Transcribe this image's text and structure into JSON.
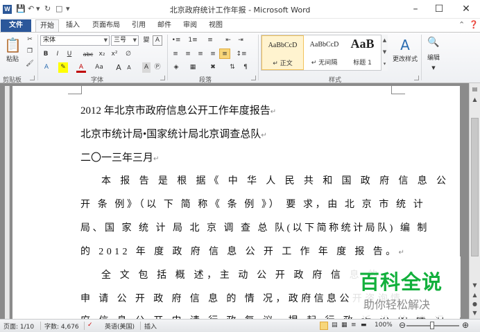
{
  "titlebar": {
    "app_icon": "W",
    "title": "北京政府统计工作年报 - Microsoft Word",
    "qat": [
      "save-icon",
      "undo-icon",
      "redo-icon",
      "new-doc-icon",
      "customize-qat-icon"
    ],
    "buttons": [
      "minimize-icon",
      "maximize-icon",
      "close-icon"
    ]
  },
  "tabs": [
    "文件",
    "开始",
    "插入",
    "页面布局",
    "引用",
    "邮件",
    "审阅",
    "视图"
  ],
  "ribbon": {
    "clipboard": {
      "paste": "粘贴",
      "label": "剪贴板"
    },
    "font": {
      "name": "宋体",
      "size": "三号",
      "wen": "變",
      "A_box": "A",
      "label": "字体",
      "row2": [
        "B",
        "I",
        "U",
        "abc",
        "x₂",
        "x²"
      ],
      "row3": [
        "Aa",
        "A",
        "A"
      ]
    },
    "paragraph": {
      "label": "段落"
    },
    "styles": {
      "items": [
        {
          "preview": "AaBbCcD",
          "name": "↵ 正文"
        },
        {
          "preview": "AaBbCcD",
          "name": "↵ 无间隔"
        },
        {
          "preview": "AaB",
          "name": "标题 1"
        }
      ],
      "change_styles": "更改样式",
      "label": "样式"
    },
    "editing": {
      "label": "编辑"
    }
  },
  "document": {
    "lines": [
      "2012 年北京市政府信息公开工作年度报告",
      "北京市统计局•国家统计局北京调查总队",
      "二〇一三年三月"
    ],
    "para1": [
      "本 报 告 是 根 据《 中 华 人 民 共 和 国 政 府 信 息 公",
      "开 条 例》（以 下 简 称《 条 例 》） 要 求，由 北 京 市 统 计",
      "局、国 家 统 计 局 北 京 调 查 总 队(以下简称统计局队) 编 制",
      "的 2012 年 度 政 府 信 息 公 开 工 作 年 度 报 告。"
    ],
    "para2": [
      "全 文 包 括 概 述，主 动 公 开 政 府 信 息 的",
      "申 请 公 开 政 府 信 息 的 情 况，政府信息公开咨询情",
      "府 信 息 公 开 申 请 行 政 复 议、提 起 行 政 诉 讼 的 情 况"
    ]
  },
  "watermark": {
    "title": "百科全说",
    "subtitle": "助你轻松解决"
  },
  "status": {
    "page": "页面: 1/10",
    "words": "字数: 4,676",
    "language": "英语(美国)",
    "mode": "插入",
    "zoom": "100%",
    "zoom_level": 1.0
  }
}
